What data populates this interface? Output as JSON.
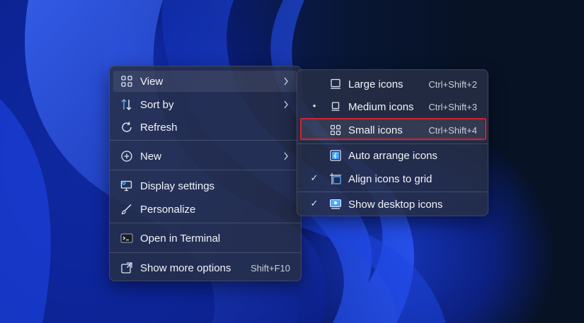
{
  "context_menu": {
    "items": [
      {
        "label": "View",
        "icon": "grid-icon",
        "submenu": true
      },
      {
        "label": "Sort by",
        "icon": "sort-icon",
        "submenu": true
      },
      {
        "label": "Refresh",
        "icon": "refresh-icon"
      },
      {
        "label": "New",
        "icon": "plus-circle-icon",
        "submenu": true
      },
      {
        "label": "Display settings",
        "icon": "monitor-settings-icon"
      },
      {
        "label": "Personalize",
        "icon": "brush-icon"
      },
      {
        "label": "Open in Terminal",
        "icon": "terminal-icon"
      },
      {
        "label": "Show more options",
        "icon": "expand-icon",
        "shortcut": "Shift+F10"
      }
    ]
  },
  "view_submenu": {
    "items": [
      {
        "label": "Large icons",
        "shortcut": "Ctrl+Shift+2",
        "icon": "large-monitor-icon",
        "mark": ""
      },
      {
        "label": "Medium icons",
        "shortcut": "Ctrl+Shift+3",
        "icon": "medium-monitor-icon",
        "mark": "•"
      },
      {
        "label": "Small icons",
        "shortcut": "Ctrl+Shift+4",
        "icon": "small-grid-icon",
        "mark": ""
      },
      {
        "label": "Auto arrange icons",
        "icon": "auto-arrange-icon",
        "mark": ""
      },
      {
        "label": "Align icons to grid",
        "icon": "align-grid-icon",
        "mark": "✓"
      },
      {
        "label": "Show desktop icons",
        "icon": "desktop-icon",
        "mark": "✓"
      }
    ]
  },
  "colors": {
    "highlight_border": "#d0242e",
    "menu_bg": "#262e46",
    "accent": "#4aa8ff"
  }
}
